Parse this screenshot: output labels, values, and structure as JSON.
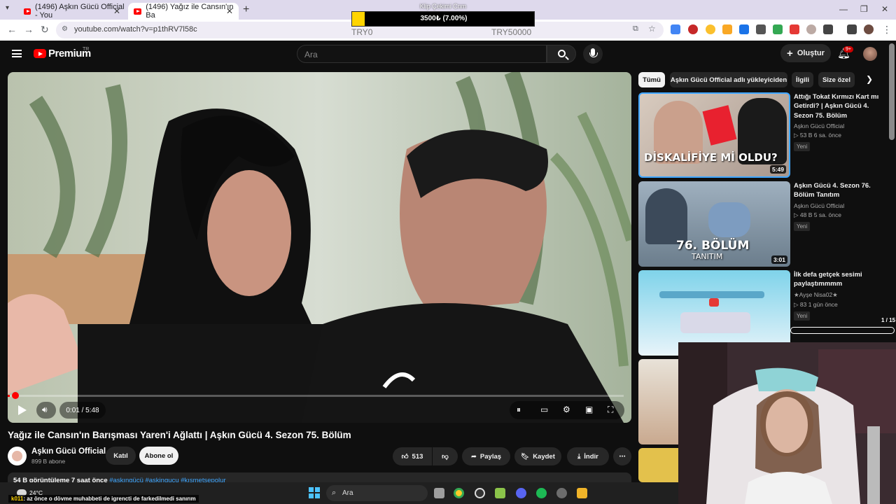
{
  "browser": {
    "tabs": [
      {
        "title": "(1496) Aşkın Gücü Official - You",
        "active": false
      },
      {
        "title": "(1496) Yağız ile Cansın'ın Ba",
        "active": true
      }
    ],
    "url": "youtube.com/watch?v=p1thRV7l58c"
  },
  "overlay": {
    "title": "Klip Çekimi Cnm",
    "progress_text": "3500₺ (7.00%)",
    "progress_fraction": 0.07,
    "min_label": "TRY0",
    "max_label": "TRY50000",
    "fill_color": "#ffd400"
  },
  "yt": {
    "brand": "Premium",
    "country": "TR",
    "search_placeholder": "Ara",
    "create_label": "Oluştur",
    "notif_count": "9+"
  },
  "player": {
    "time": "0:01 / 5:48",
    "progress_fraction": 0.003
  },
  "video": {
    "title": "Yağız ile Cansın'ın Barışması Yaren'i Ağlattı | Aşkın Gücü 4. Sezon 75. Bölüm",
    "channel": "Aşkın Gücü Official",
    "subs": "899 B abone",
    "join_label": "Katıl",
    "subscribe_label": "Abone ol",
    "likes": "513",
    "share_label": "Paylaş",
    "save_label": "Kaydet",
    "download_label": "İndir",
    "desc_stats": "54 B görüntüleme  7 saat önce",
    "desc_tags": "#aşkıngücü #askingucu #kısmetsepolur"
  },
  "sidebar": {
    "chips": [
      "Tümü",
      "Aşkın Gücü Official adlı yükleyiciden",
      "İlgili",
      "Size özel"
    ],
    "videos": [
      {
        "title": "Attığı Tokat Kırmızı Kart mı Getirdi? | Aşkın Gücü 4. Sezon 75. Bölüm",
        "channel": "Aşkın Gücü Official",
        "stats": "▷ 53 B   6 sa. önce",
        "badge": "Yeni",
        "duration": "5:49",
        "caption": "DİSKALİFİYE Mİ OLDU?"
      },
      {
        "title": "Aşkın Gücü 4. Sezon 76. Bölüm Tanıtım",
        "channel": "Aşkın Gücü Official",
        "stats": "▷ 48 B   5 sa. önce",
        "badge": "Yeni",
        "duration": "3:01",
        "caption": "76. BÖLÜM",
        "caption2": "TANITIM"
      },
      {
        "title": "İlk defa getçek sesimi paylaştımmmm",
        "channel": "★Ayşe Nisa02★",
        "stats": "▷ 83   1 gün önce",
        "badge": "Yeni",
        "duration": "",
        "caption": ""
      }
    ],
    "counter": "1 / 15"
  },
  "taskbar": {
    "temp": "24°C",
    "search_label": "Ara"
  },
  "chat": {
    "user": "k011",
    "message": ": az önce o dövme muhabbeti de igrencti de farkedilmedi sanırım"
  }
}
